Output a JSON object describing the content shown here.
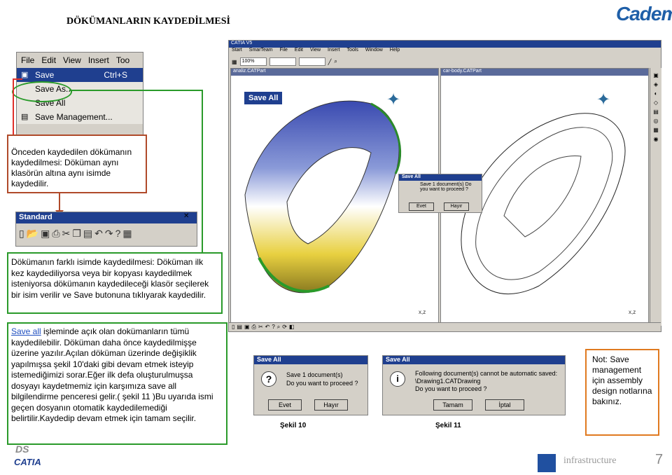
{
  "page_title": "DÖKÜMANLARIN KAYDEDİLMESİ",
  "logo": "Cadem.",
  "file_menu": {
    "menubar": [
      "File",
      "Edit",
      "View",
      "Insert",
      "Too"
    ],
    "items": [
      {
        "label": "Save",
        "accel": "Ctrl+S"
      },
      {
        "label": "Save As...",
        "accel": ""
      },
      {
        "label": "Save All",
        "accel": ""
      },
      {
        "label": "Save Management...",
        "accel": ""
      }
    ]
  },
  "callout_save": "Önceden kaydedilen dökümanın kaydedilmesi: Döküman aynı klasörün altına aynı isimde kaydedilir.",
  "standard_toolbar": {
    "title": "Standard"
  },
  "callout_saveas": "Dökümanın farklı isimde kaydedilmesi: Döküman ilk kez kaydediliyorsa veya bir kopyası kaydedilmek isteniyorsa dökümanın kaydedileceği klasör seçilerek bir isim verilir ve Save butonuna tıklıyarak kaydedilir.",
  "callout_saveall": {
    "link": "Save all",
    "text": " işleminde açık olan dokümanların tümü kaydedilebilir. Döküman daha önce kaydedilmişşe üzerine yazılır.Açılan döküman üzerinde değişiklik yapılmışsa şekil 10'daki gibi devam etmek isteyip istemediğimizi sorar.Eğer ilk defa oluşturulmuşsa dosyayı kaydetmemiz için karşımıza save all bilgilendirme penceresi gelir.( şekil 11 )Bu uyarıda ismi geçen dosyanın otomatik kaydedilemediği belirtilir.Kaydedip devam etmek için tamam seçilir."
  },
  "catia": {
    "title": "CATIA V5",
    "menu": [
      "Start",
      "SmarTeam",
      "File",
      "Edit",
      "View",
      "Insert",
      "Tools",
      "Window",
      "Help"
    ],
    "zoom": "100%",
    "left_window": "analiz.CATPart",
    "right_window": "car-body.CATPart",
    "save_all_button": "Save All",
    "axis_label": "x,z"
  },
  "dialog_small": {
    "title": "Save All",
    "message": "Save 1 document(s) Do you want to proceed ?",
    "yes": "Evet",
    "no": "Hayır"
  },
  "dialog10": {
    "title": "Save All",
    "line1": "Save 1 document(s)",
    "line2": "Do you want to proceed ?",
    "yes": "Evet",
    "no": "Hayır",
    "caption": "Şekil 10"
  },
  "dialog11": {
    "title": "Save All",
    "line1": "Following document(s) cannot be automatic saved:",
    "line2": "\\Drawing1.CATDrawing",
    "line3": "Do you want to proceed ?",
    "ok": "Tamam",
    "cancel": "İptal",
    "caption": "Şekil  11"
  },
  "note": "Not: Save management için assembly design notlarına bakınız.",
  "footer": {
    "infrastructure": "infrastructure",
    "page_number": "7",
    "catia": "CATIA",
    "ds": "DS"
  },
  "colors": {
    "green": "#2a9a2a",
    "red": "#b04a2a",
    "orange": "#e07a20",
    "title_blue": "#1f3f8f"
  }
}
